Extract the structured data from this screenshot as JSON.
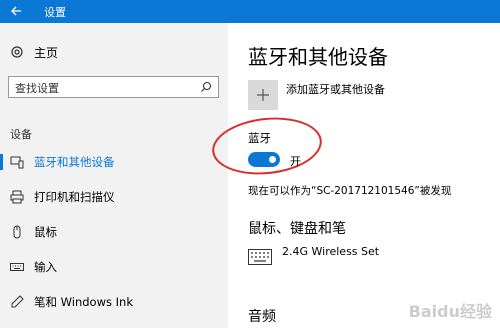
{
  "window": {
    "title": "设置"
  },
  "sidebar": {
    "home_label": "主页",
    "search_placeholder": "查找设置",
    "section_label": "设备",
    "items": [
      {
        "label": "蓝牙和其他设备",
        "icon": "bluetooth-devices-icon",
        "active": true
      },
      {
        "label": "打印机和扫描仪",
        "icon": "printer-icon"
      },
      {
        "label": "鼠标",
        "icon": "mouse-icon"
      },
      {
        "label": "输入",
        "icon": "keyboard-icon"
      },
      {
        "label": "笔和 Windows Ink",
        "icon": "pen-icon"
      }
    ]
  },
  "main": {
    "title": "蓝牙和其他设备",
    "add_label": "添加蓝牙或其他设备",
    "bluetooth_label": "蓝牙",
    "toggle_state": "开",
    "discoverable_text": "现在可以作为“SC-201712101546”被发现",
    "mouse_kb_title": "鼠标、键盘和笔",
    "device_name": "2.4G Wireless Set",
    "audio_title": "音频"
  },
  "watermark": "Baidu经验",
  "colors": {
    "accent": "#0b78d6",
    "annotation": "#d92d2d",
    "sidebar_bg": "#f2f2f2"
  }
}
